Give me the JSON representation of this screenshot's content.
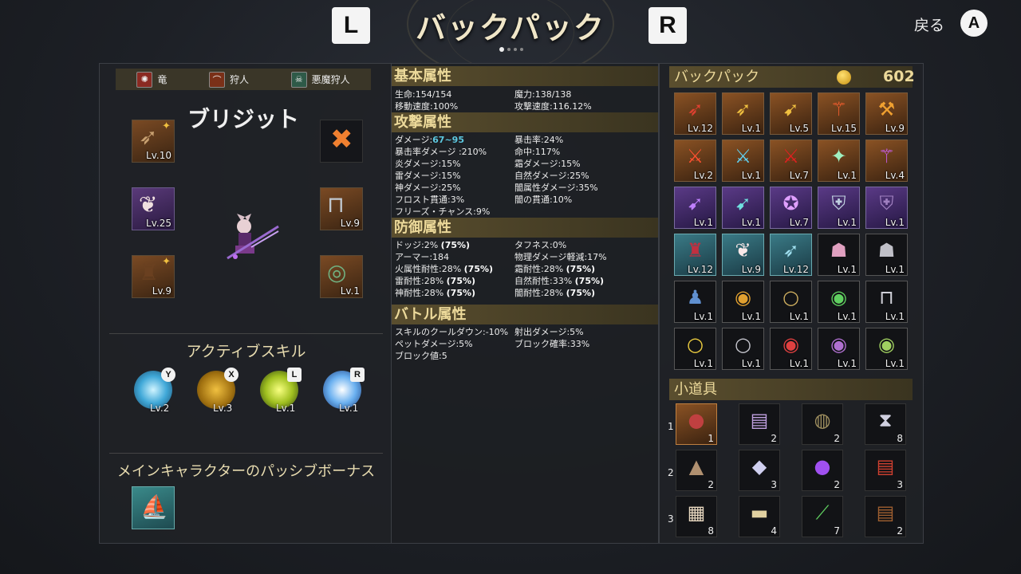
{
  "header": {
    "title": "バックパック",
    "left_button": "L",
    "right_button": "R",
    "back_label": "戻る",
    "back_button": "A"
  },
  "classes": [
    {
      "label": "竜",
      "icon": "dragon-icon",
      "color": "#c0392b"
    },
    {
      "label": "狩人",
      "icon": "bow-icon",
      "color": "#a04020"
    },
    {
      "label": "悪魔狩人",
      "icon": "skull-icon",
      "color": "#4a8a6a"
    }
  ],
  "character": {
    "name": "ブリジット",
    "equipment": {
      "weapon": {
        "level": "Lv.10",
        "icon": "crossbow-icon"
      },
      "helmet": {
        "level": "Lv.25",
        "icon": "cat-ears-icon"
      },
      "armor": {
        "level": "Lv.9",
        "icon": "leather-armor-icon"
      },
      "remove": {
        "icon": "remove-x-icon"
      },
      "accessory": {
        "level": "Lv.9",
        "icon": "bracer-icon"
      },
      "ring": {
        "level": "Lv.1",
        "icon": "ring-icon"
      }
    }
  },
  "skills": {
    "title": "アクティブスキル",
    "items": [
      {
        "button": "Y",
        "level": "Lv.2",
        "icon": "ice-burst-icon"
      },
      {
        "button": "X",
        "level": "Lv.3",
        "icon": "rock-shield-icon"
      },
      {
        "button": "L",
        "level": "Lv.1",
        "icon": "lightning-icon"
      },
      {
        "button": "R",
        "level": "Lv.1",
        "icon": "ice-orb-icon"
      }
    ]
  },
  "passive": {
    "title": "メインキャラクターのパッシブボーナス",
    "icon": "ship-icon"
  },
  "stats": {
    "basic": {
      "title": "基本属性",
      "items": [
        "生命:154/154",
        "魔力:138/138",
        "移動速度:100%",
        "攻撃速度:116.12%"
      ]
    },
    "attack": {
      "title": "攻撃属性",
      "damage_label": "ダメージ:",
      "damage_value": "67~95",
      "items": [
        "暴击率:24%",
        "暴击率ダメージ :210%",
        "命中:117%",
        "炎ダメージ:15%",
        "霜ダメージ:15%",
        "雷ダメージ:15%",
        "自然ダメージ:25%",
        "神ダメージ:25%",
        "闇属性ダメージ:35%",
        "フロスト貫通:3%",
        "闇の貫通:10%",
        "フリーズ・チャンス:9%"
      ]
    },
    "defense": {
      "title": "防御属性",
      "dodge": "ドッジ:2%",
      "dodge_cap": "(75%)",
      "toughness": "タフネス:0%",
      "armor": "アーマー:184",
      "phys_reduce": "物理ダメージ軽減:17%",
      "fire_res": "火属性耐性:28%",
      "fire_cap": "(75%)",
      "frost_res": "霜耐性:28%",
      "frost_cap": "(75%)",
      "thunder_res": "雷耐性:28%",
      "thunder_cap": "(75%)",
      "nature_res": "自然耐性:33%",
      "nature_cap": "(75%)",
      "holy_res": "神耐性:28%",
      "holy_cap": "(75%)",
      "dark_res": "闇耐性:28%",
      "dark_cap": "(75%)"
    },
    "battle": {
      "title": "バトル属性",
      "items": [
        "スキルのクールダウン:-10%",
        "射出ダメージ:5%",
        "ペットダメージ:5%",
        "ブロック確率:33%",
        "ブロック値:5"
      ]
    }
  },
  "backpack": {
    "title": "バックパック",
    "gold": "602",
    "items": [
      {
        "level": "Lv.12",
        "icon": "red-crossbow-icon",
        "style": "orange"
      },
      {
        "level": "Lv.1",
        "icon": "golden-crossbow-icon",
        "style": "orange"
      },
      {
        "level": "Lv.5",
        "icon": "golden-bow-icon",
        "style": "orange"
      },
      {
        "level": "Lv.15",
        "icon": "fire-staff-icon",
        "style": "orange"
      },
      {
        "level": "Lv.9",
        "icon": "golden-axe-icon",
        "style": "orange"
      },
      {
        "level": "Lv.2",
        "icon": "fire-sword-icon",
        "style": "orange"
      },
      {
        "level": "Lv.1",
        "icon": "ice-sword-icon",
        "style": "orange"
      },
      {
        "level": "Lv.7",
        "icon": "red-sword-icon",
        "style": "orange"
      },
      {
        "level": "Lv.1",
        "icon": "crystal-dagger-icon",
        "style": "orange"
      },
      {
        "level": "Lv.4",
        "icon": "orb-staff-icon",
        "style": "orange"
      },
      {
        "level": "Lv.1",
        "icon": "dark-bow-icon",
        "style": "purple"
      },
      {
        "level": "Lv.1",
        "icon": "ice-bow-icon",
        "style": "purple"
      },
      {
        "level": "Lv.7",
        "icon": "magic-circle-icon",
        "style": "purple"
      },
      {
        "level": "Lv.1",
        "icon": "ice-shield-icon",
        "style": "purple"
      },
      {
        "level": "Lv.1",
        "icon": "dark-shield-icon",
        "style": "purple"
      },
      {
        "level": "Lv.12",
        "icon": "dark-armor-icon",
        "style": "teal"
      },
      {
        "level": "Lv.9",
        "icon": "cat-ears-icon",
        "style": "teal"
      },
      {
        "level": "Lv.12",
        "icon": "ice-crossbow-icon",
        "style": "teal"
      },
      {
        "level": "Lv.1",
        "icon": "pink-helmet-icon",
        "style": "dark"
      },
      {
        "level": "Lv.1",
        "icon": "chest-armor-icon",
        "style": "dark"
      },
      {
        "level": "Lv.1",
        "icon": "blue-robe-icon",
        "style": "dark"
      },
      {
        "level": "Lv.1",
        "icon": "ruby-ring-icon",
        "style": "dark"
      },
      {
        "level": "Lv.1",
        "icon": "gold-ring-icon",
        "style": "dark"
      },
      {
        "level": "Lv.1",
        "icon": "emerald-ring-icon",
        "style": "dark"
      },
      {
        "level": "Lv.1",
        "icon": "silver-bracer-icon",
        "style": "dark"
      },
      {
        "level": "Lv.1",
        "icon": "yellow-ring-icon",
        "style": "dark"
      },
      {
        "level": "Lv.1",
        "icon": "silver-ring-icon",
        "style": "dark"
      },
      {
        "level": "Lv.1",
        "icon": "red-gem-ring-icon",
        "style": "dark"
      },
      {
        "level": "Lv.1",
        "icon": "amethyst-ring-icon",
        "style": "dark"
      },
      {
        "level": "Lv.1",
        "icon": "green-gem-ring-icon",
        "style": "dark"
      }
    ]
  },
  "tools": {
    "title": "小道具",
    "rows": [
      "1",
      "2",
      "3"
    ],
    "items": [
      {
        "count": "1",
        "icon": "meat-icon"
      },
      {
        "count": "2",
        "icon": "spellbook-icon"
      },
      {
        "count": "2",
        "icon": "bag-icon"
      },
      {
        "count": "8",
        "icon": "hourglass-icon"
      },
      {
        "count": "2",
        "icon": "pyramid-icon"
      },
      {
        "count": "3",
        "icon": "crystal-icon"
      },
      {
        "count": "2",
        "icon": "purple-orb-icon"
      },
      {
        "count": "3",
        "icon": "red-book-icon"
      },
      {
        "count": "8",
        "icon": "map-scroll-icon"
      },
      {
        "count": "4",
        "icon": "scroll-icon"
      },
      {
        "count": "7",
        "icon": "green-wand-icon"
      },
      {
        "count": "2",
        "icon": "brown-book-icon"
      }
    ]
  }
}
